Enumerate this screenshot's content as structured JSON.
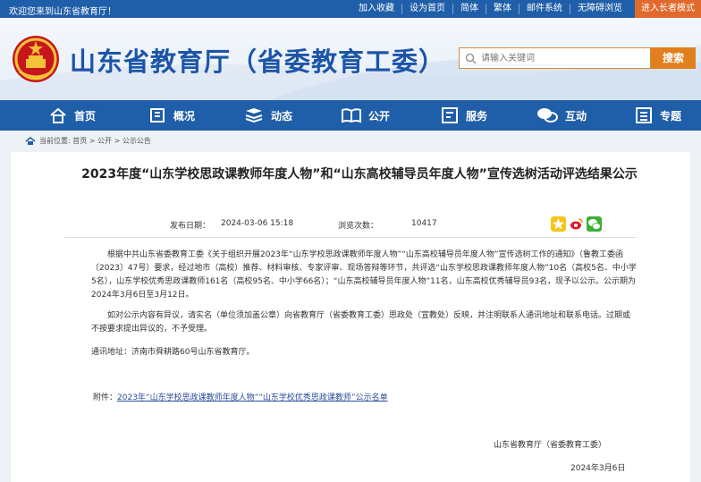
{
  "topbar": {
    "welcome": "欢迎您来到山东省教育厅！",
    "links": [
      "加入收藏",
      "设为首页",
      "简体",
      "繁体",
      "邮件系统",
      "无障碍浏览"
    ],
    "elder_mode": "进入长者模式"
  },
  "header": {
    "site_title": "山东省教育厅（省委教育工委）",
    "search_placeholder": "请输入关键词",
    "search_button": "搜索"
  },
  "nav": {
    "items": [
      {
        "label": "首页",
        "icon": "home-icon"
      },
      {
        "label": "概况",
        "icon": "building-icon"
      },
      {
        "label": "动态",
        "icon": "news-icon"
      },
      {
        "label": "公开",
        "icon": "book-icon"
      },
      {
        "label": "服务",
        "icon": "service-icon"
      },
      {
        "label": "互动",
        "icon": "chat-icon"
      },
      {
        "label": "专题",
        "icon": "topic-icon"
      }
    ]
  },
  "breadcrumb": {
    "text": "当前位置: 首页 > 公开 > 公示公告"
  },
  "article": {
    "title": "2023年度“山东学校思政课教师年度人物”和“山东高校辅导员年度人物”宣传选树活动评选结果公示",
    "published_label": "发布日期：",
    "published_value": "2024-03-06 15:18",
    "views_label": "浏览次数：",
    "views_value": "10417",
    "p1": "根据中共山东省委教育工委《关于组织开展2023年“山东学校思政课教师年度人物”“山东高校辅导员年度人物”宣传选树工作的通知》（鲁教工委函〔2023〕47号）要求，经过地市（高校）推荐、材料审核、专家评审、现场答辩等环节，共评选“山东学校思政课教师年度人物”10名（高校5名、中小学5名），山东学校优秀思政课教师161名（高校95名、中小学66名）；“山东高校辅导员年度人物”11名，山东高校优秀辅导员93名，现予以公示。公示期为2024年3月6日至3月12日。",
    "p2": "如对公示内容有异议，请实名（单位须加盖公章）向省教育厅（省委教育工委）思政处（宣教处）反映，并注明联系人通讯地址和联系电话。过期或不按要求提出异议的，不予受理。",
    "p3": "通讯地址：济南市舜耕路60号山东省教育厅。",
    "attachment_label": "附件：",
    "attachment_link": "2023年“山东学校思政课教师年度人物”“山东学校优秀思政课教师”公示名单",
    "signature": "山东省教育厅（省委教育工委）",
    "date": "2024年3月6日"
  },
  "colors": {
    "primary_blue": "#1f5ea8",
    "accent_orange": "#e27f1d",
    "title_blue": "#1c55a8"
  }
}
